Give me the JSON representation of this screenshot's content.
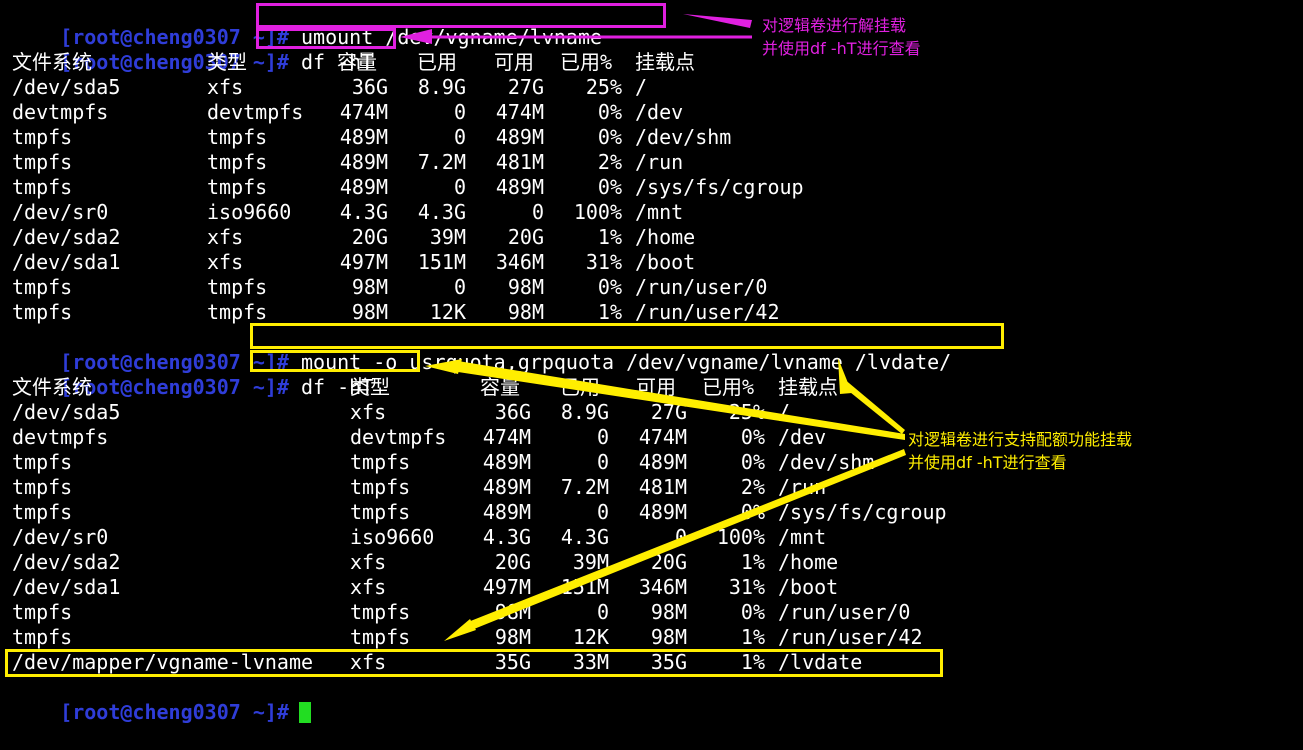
{
  "prompt": "[root@cheng0307 ~]#",
  "commands": {
    "umount": "umount /dev/vgname/lvname",
    "df1": "df -hT",
    "mount": "mount -o usrquota,grpquota /dev/vgname/lvname /lvdate/",
    "df2": "df -hT"
  },
  "headers": [
    "文件系统",
    "类型",
    "容量",
    "已用",
    "可用",
    "已用%",
    "挂载点"
  ],
  "table1": [
    [
      "/dev/sda5",
      "xfs",
      "36G",
      "8.9G",
      "27G",
      "25%",
      "/"
    ],
    [
      "devtmpfs",
      "devtmpfs",
      "474M",
      "0",
      "474M",
      "0%",
      "/dev"
    ],
    [
      "tmpfs",
      "tmpfs",
      "489M",
      "0",
      "489M",
      "0%",
      "/dev/shm"
    ],
    [
      "tmpfs",
      "tmpfs",
      "489M",
      "7.2M",
      "481M",
      "2%",
      "/run"
    ],
    [
      "tmpfs",
      "tmpfs",
      "489M",
      "0",
      "489M",
      "0%",
      "/sys/fs/cgroup"
    ],
    [
      "/dev/sr0",
      "iso9660",
      "4.3G",
      "4.3G",
      "0",
      "100%",
      "/mnt"
    ],
    [
      "/dev/sda2",
      "xfs",
      "20G",
      "39M",
      "20G",
      "1%",
      "/home"
    ],
    [
      "/dev/sda1",
      "xfs",
      "497M",
      "151M",
      "346M",
      "31%",
      "/boot"
    ],
    [
      "tmpfs",
      "tmpfs",
      "98M",
      "0",
      "98M",
      "0%",
      "/run/user/0"
    ],
    [
      "tmpfs",
      "tmpfs",
      "98M",
      "12K",
      "98M",
      "1%",
      "/run/user/42"
    ]
  ],
  "table2": [
    [
      "/dev/sda5",
      "xfs",
      "36G",
      "8.9G",
      "27G",
      "25%",
      "/"
    ],
    [
      "devtmpfs",
      "devtmpfs",
      "474M",
      "0",
      "474M",
      "0%",
      "/dev"
    ],
    [
      "tmpfs",
      "tmpfs",
      "489M",
      "0",
      "489M",
      "0%",
      "/dev/shm"
    ],
    [
      "tmpfs",
      "tmpfs",
      "489M",
      "7.2M",
      "481M",
      "2%",
      "/run"
    ],
    [
      "tmpfs",
      "tmpfs",
      "489M",
      "0",
      "489M",
      "0%",
      "/sys/fs/cgroup"
    ],
    [
      "/dev/sr0",
      "iso9660",
      "4.3G",
      "4.3G",
      "0",
      "100%",
      "/mnt"
    ],
    [
      "/dev/sda2",
      "xfs",
      "20G",
      "39M",
      "20G",
      "1%",
      "/home"
    ],
    [
      "/dev/sda1",
      "xfs",
      "497M",
      "151M",
      "346M",
      "31%",
      "/boot"
    ],
    [
      "tmpfs",
      "tmpfs",
      "98M",
      "0",
      "98M",
      "0%",
      "/run/user/0"
    ],
    [
      "tmpfs",
      "tmpfs",
      "98M",
      "12K",
      "98M",
      "1%",
      "/run/user/42"
    ],
    [
      "/dev/mapper/vgname-lvname",
      "xfs",
      "35G",
      "33M",
      "35G",
      "1%",
      "/lvdate"
    ]
  ],
  "annotations": {
    "unmount_note": "对逻辑卷进行解挂载\n并使用df -hT进行查看",
    "quota_note": "对逻辑卷进行支持配额功能挂载\n并使用df -hT进行查看"
  },
  "colors": {
    "background": "#000000",
    "prompt": "#2f3dd8",
    "text": "#ffffff",
    "cursor": "#22dd22",
    "magenta_annotation": "#e020e0",
    "yellow_annotation": "#ffee00"
  }
}
